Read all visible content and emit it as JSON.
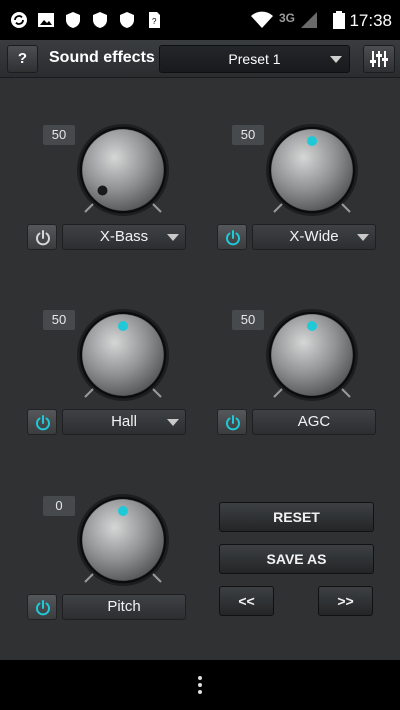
{
  "status_bar": {
    "time": "17:38",
    "network": "3G",
    "icons": [
      "sync-icon",
      "image-icon",
      "shield-icon",
      "shield-icon",
      "shield-icon",
      "sdcard-icon",
      "wifi-icon",
      "signal-icon",
      "battery-icon"
    ]
  },
  "app_bar": {
    "help_label": "?",
    "title": "Sound effects",
    "preset": "Preset 1",
    "equalizer_icon": "equalizer-icon"
  },
  "effects": {
    "xbass": {
      "value": "50",
      "label": "X-Bass",
      "enabled": false,
      "level": 0
    },
    "xwide": {
      "value": "50",
      "label": "X-Wide",
      "enabled": true,
      "level": 0.5
    },
    "hall": {
      "value": "50",
      "label": "Hall",
      "enabled": true,
      "level": 0.5
    },
    "agc": {
      "value": "50",
      "label": "AGC",
      "enabled": true,
      "level": 0.5
    },
    "pitch": {
      "value": "0",
      "label": "Pitch",
      "enabled": true,
      "level": 0.5
    }
  },
  "actions": {
    "reset": "RESET",
    "save_as": "SAVE AS",
    "prev": "<<",
    "next": ">>"
  },
  "colors": {
    "accent": "#1fc9d8",
    "panel": "#2f3133",
    "indicator_off": "#1a1a1a"
  }
}
